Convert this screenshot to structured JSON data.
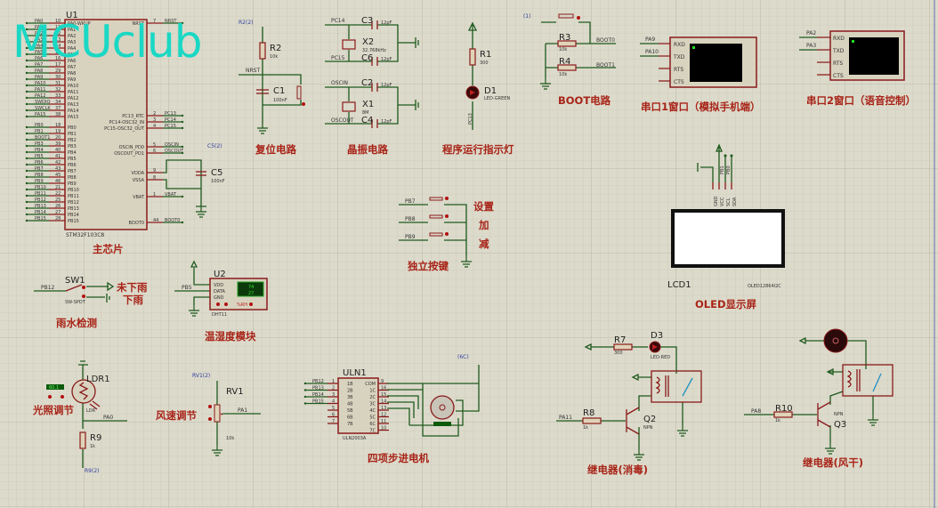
{
  "watermark": "MCUclub",
  "colors": {
    "background": "#dcdacb",
    "wire": "#1e5a1e",
    "component": "#8a1a1a",
    "title": "#a82418",
    "watermark": "#19d8c4"
  },
  "mcu": {
    "ref": "U1",
    "part": "STM32F103C8",
    "title": "主芯片",
    "left_pins": [
      {
        "net": "PA0",
        "num": "10",
        "name": "PA0-WKUP"
      },
      {
        "net": "PA1",
        "num": "11",
        "name": "PA1"
      },
      {
        "net": "PA2",
        "num": "12",
        "name": "PA2"
      },
      {
        "net": "PA3",
        "num": "13",
        "name": "PA3"
      },
      {
        "net": "PA4",
        "num": "14",
        "name": "PA4"
      },
      {
        "net": "PA5",
        "num": "15",
        "name": "PA5"
      },
      {
        "net": "PA6",
        "num": "16",
        "name": "PA6"
      },
      {
        "net": "PA7",
        "num": "17",
        "name": "PA7"
      },
      {
        "net": "PA8",
        "num": "29",
        "name": "PA8"
      },
      {
        "net": "PA9",
        "num": "30",
        "name": "PA9"
      },
      {
        "net": "PA10",
        "num": "31",
        "name": "PA10"
      },
      {
        "net": "PA11",
        "num": "32",
        "name": "PA11"
      },
      {
        "net": "PA12",
        "num": "33",
        "name": "PA12"
      },
      {
        "net": "SWDIO",
        "num": "34",
        "name": "PA13"
      },
      {
        "net": "SWCLK",
        "num": "37",
        "name": "PA14"
      },
      {
        "net": "PA15",
        "num": "38",
        "name": "PA15"
      },
      {
        "net": "PB0",
        "num": "18",
        "name": "PB0"
      },
      {
        "net": "PB1",
        "num": "19",
        "name": "PB1"
      },
      {
        "net": "BOOT1",
        "num": "20",
        "name": "PB2"
      },
      {
        "net": "PB3",
        "num": "39",
        "name": "PB3"
      },
      {
        "net": "PB4",
        "num": "40",
        "name": "PB4"
      },
      {
        "net": "PB5",
        "num": "41",
        "name": "PB5"
      },
      {
        "net": "PB6",
        "num": "42",
        "name": "PB6"
      },
      {
        "net": "PB7",
        "num": "43",
        "name": "PB7"
      },
      {
        "net": "PB8",
        "num": "45",
        "name": "PB8"
      },
      {
        "net": "PB9",
        "num": "46",
        "name": "PB9"
      },
      {
        "net": "PB10",
        "num": "21",
        "name": "PB10"
      },
      {
        "net": "PB11",
        "num": "22",
        "name": "PB11"
      },
      {
        "net": "PB12",
        "num": "25",
        "name": "PB12"
      },
      {
        "net": "PB13",
        "num": "26",
        "name": "PB13"
      },
      {
        "net": "PB14",
        "num": "27",
        "name": "PB14"
      },
      {
        "net": "PB15",
        "num": "28",
        "name": "PB15"
      }
    ],
    "right_pins": [
      {
        "net": "NRST",
        "num": "7",
        "name": "NRST"
      },
      {
        "net": "PC13",
        "num": "2",
        "name": "PC13_RTC"
      },
      {
        "net": "PC14",
        "num": "3",
        "name": "PC14-OSC32_IN"
      },
      {
        "net": "PC15",
        "num": "4",
        "name": "PC15-OSC32_OUT"
      },
      {
        "net": "OSCIN",
        "num": "5",
        "name": "OSCIN_PD0"
      },
      {
        "net": "OSCOUT",
        "num": "6",
        "name": "OSCOUT_PD1"
      },
      {
        "net": "",
        "num": "9",
        "name": "VDDA"
      },
      {
        "net": "",
        "num": "8",
        "name": "VSSA"
      },
      {
        "net": "VBAT",
        "num": "1",
        "name": "VBAT"
      },
      {
        "net": "BOOT0",
        "num": "44",
        "name": "BOOT0"
      }
    ],
    "c5": {
      "ref": "C5",
      "value": "100nF",
      "probe": "C5(2)"
    }
  },
  "reset": {
    "title": "复位电路",
    "probe": "R2(2)",
    "r_ref": "R2",
    "r_val": "10k",
    "net": "NRST",
    "c_ref": "C1",
    "c_val": "100nF"
  },
  "crystal": {
    "title": "晶振电路",
    "n1": "PC14",
    "n2": "PC15",
    "n3": "OSCIN",
    "n4": "OSCOUT",
    "c3": "C3",
    "c6": "C6",
    "c2": "C2",
    "c4": "C4",
    "cval": "12pF",
    "x2": "X2",
    "x2_val": "32.768kHz",
    "x1": "X1",
    "x1_val": "8M"
  },
  "led": {
    "title": "程序运行指示灯",
    "r_ref": "R1",
    "r_val": "300",
    "d_ref": "D1",
    "d_val": "LED-GREEN",
    "net": "PC13"
  },
  "boot": {
    "title": "BOOT电路",
    "probe": "(1)",
    "r3": "R3",
    "r4": "R4",
    "rval": "10k",
    "net0": "BOOT0",
    "net1": "BOOT1"
  },
  "uart1": {
    "title": "串口1窗口（模拟手机端）",
    "n1": "PA9",
    "n2": "PA10",
    "pins": [
      "RXD",
      "TXD",
      "RTS",
      "CTS"
    ]
  },
  "uart2": {
    "title": "串口2窗口（语音控制）",
    "n1": "PA2",
    "n2": "PA3",
    "pins": [
      "RXD",
      "TXD",
      "RTS",
      "CTS"
    ]
  },
  "keys": {
    "title": "独立按键",
    "nets": [
      "PB7",
      "PB8",
      "PB9"
    ],
    "labels": [
      "设置",
      "加",
      "减"
    ]
  },
  "oled": {
    "title": "OLED显示屏",
    "ref": "LCD1",
    "part": "OLED12864I2C",
    "pins": [
      "GND",
      "VCC",
      "SCL",
      "SDA"
    ],
    "nets": [
      "PB1",
      "PB0"
    ]
  },
  "rain": {
    "title": "雨水检测",
    "net": "PB12",
    "ref": "SW1",
    "part": "SW-SPDT",
    "l1": "未下雨",
    "l2": "下雨"
  },
  "dht": {
    "title": "温湿度模块",
    "ref": "U2",
    "part": "DHT11",
    "net": "PB5",
    "pins": [
      "VDD",
      "DATA",
      "GND"
    ],
    "pin_nums": [
      "1",
      "2",
      "4"
    ],
    "humidity": "74",
    "temperature": "27",
    "unit": "%RH"
  },
  "ldr": {
    "title": "光照调节",
    "ref": "LDR1",
    "part": "LDR",
    "reading": "60.1",
    "net": "PA0",
    "r_ref": "R9",
    "r_val": "1k",
    "probe": "R9(2)"
  },
  "pot": {
    "title": "风速调节",
    "probe": "RV1(2)",
    "ref": "RV1",
    "val": "10k",
    "net": "PA1"
  },
  "stepper": {
    "title": "四项步进电机",
    "ref": "ULN1",
    "part": "ULN2003A",
    "probe": "(6C)",
    "nets": [
      "PB12",
      "PB13",
      "PB14",
      "PB15"
    ],
    "in_pins": [
      "1B",
      "2B",
      "3B",
      "4B",
      "5B",
      "6B",
      "7B"
    ],
    "in_nums": [
      "1",
      "2",
      "3",
      "4",
      "5",
      "6",
      "7"
    ],
    "out_pins": [
      "COM",
      "1C",
      "2C",
      "3C",
      "4C",
      "5C",
      "6C",
      "7C"
    ],
    "out_nums": [
      "9",
      "16",
      "15",
      "14",
      "13",
      "12",
      "11",
      "10"
    ]
  },
  "relay1": {
    "title": "继电器(消毒)",
    "r7": "R7",
    "r7_val": "300",
    "d3": "D3",
    "d3_val": "LED-RED",
    "net": "PA11",
    "r8": "R8",
    "r8_val": "1k",
    "q": "Q2",
    "q_val": "NPN"
  },
  "relay2": {
    "title": "继电器(风干)",
    "net": "PA8",
    "r10": "R10",
    "r10_val": "1k",
    "q": "Q3",
    "q_val": "NPN"
  }
}
